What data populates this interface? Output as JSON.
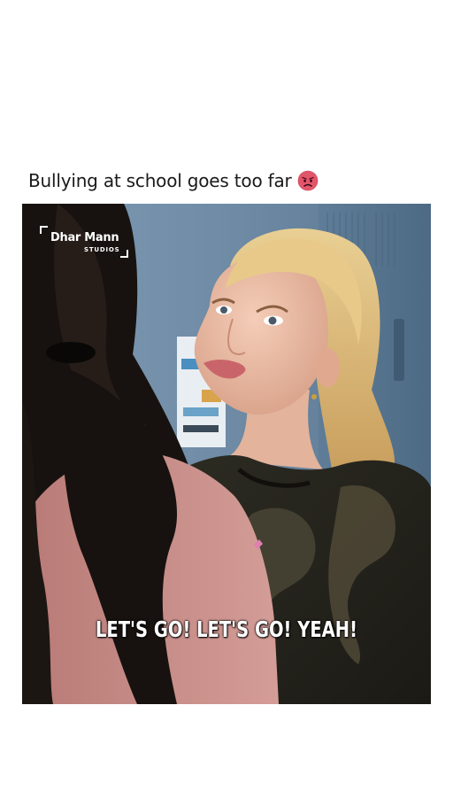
{
  "post": {
    "caption": "Bullying at school goes too far",
    "caption_emoji": "angry-face-emoji"
  },
  "video": {
    "brand_name": "Dhar Mann",
    "brand_sub": "STUDIOS",
    "subtitle": "LET'S GO! LET'S GO! YEAH!"
  },
  "colors": {
    "background": "#ffffff",
    "caption_text": "#1a1a1a",
    "subtitle_text": "#ffffff",
    "emoji_face": "#e2566b"
  }
}
